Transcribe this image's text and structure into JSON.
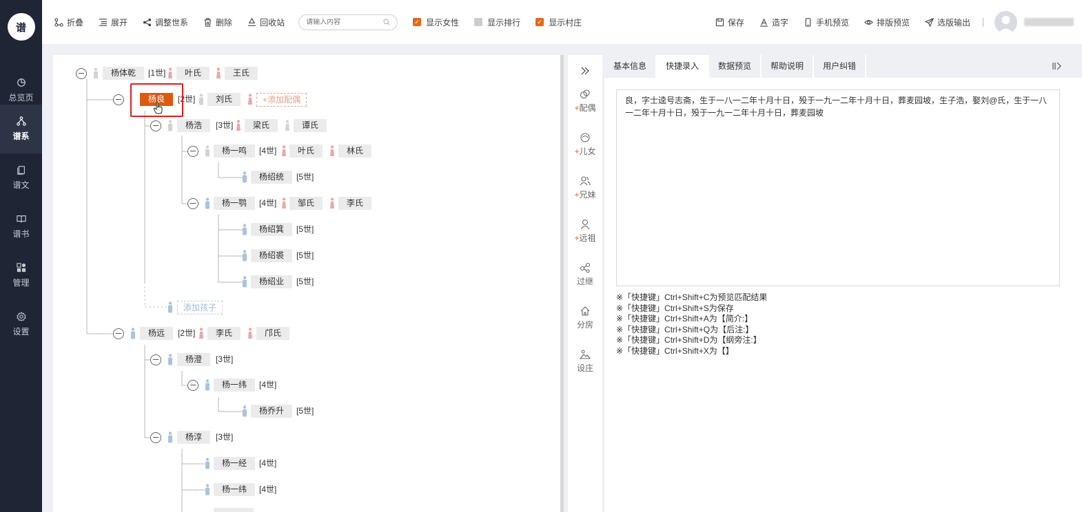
{
  "logo_text": "谱",
  "nav": [
    {
      "label": "总览页",
      "icon": "pie-chart-icon"
    },
    {
      "label": "谱系",
      "icon": "tree-icon",
      "active": true
    },
    {
      "label": "谱文",
      "icon": "document-icon"
    },
    {
      "label": "谱书",
      "icon": "book-icon"
    },
    {
      "label": "管理",
      "icon": "grid-icon"
    },
    {
      "label": "设置",
      "icon": "gear-icon"
    }
  ],
  "toolbar": {
    "collapse": "折叠",
    "expand": "展开",
    "adjust": "调整世系",
    "delete": "删除",
    "recycle": "回收站",
    "search_placeholder": "请输入内容",
    "show_female": "显示女性",
    "show_rank": "显示排行",
    "show_village": "显示村庄",
    "save": "保存",
    "make_char": "造字",
    "mobile_preview": "手机预览",
    "layout_preview": "排版预览",
    "export": "选版输出"
  },
  "checkboxes": {
    "show_female": true,
    "show_rank": false,
    "show_village": true
  },
  "accent_color": "#e0691a",
  "tree": {
    "root": {
      "name": "杨体乾",
      "gen": "[1世]",
      "spouses": [
        "叶氏",
        "王氏"
      ]
    },
    "n_yangliang": {
      "name": "杨良",
      "gen": "[2世]",
      "spouses": [
        "刘氏"
      ],
      "add_spouse": "+添加配偶"
    },
    "n_yanghao": {
      "name": "杨浩",
      "gen": "[3世]",
      "spouses": [
        "梁氏",
        "谭氏"
      ]
    },
    "n_yangyiming": {
      "name": "杨一鸣",
      "gen": "[4世]",
      "spouses": [
        "叶氏",
        "林氏"
      ]
    },
    "n_yangshaotong": {
      "name": "杨绍统",
      "gen": "[5世]"
    },
    "n_yangyipeng": {
      "name": "杨一鹗",
      "gen": "[4世]",
      "spouses": [
        "邹氏",
        "李氏"
      ]
    },
    "n_yangshaoji": {
      "name": "杨绍箕",
      "gen": "[5世]"
    },
    "n_yangshaoqiu": {
      "name": "杨绍裘",
      "gen": "[5世]"
    },
    "n_yangshaoye": {
      "name": "杨绍业",
      "gen": "[5世]"
    },
    "add_child": "添加孩子",
    "n_yangyuan": {
      "name": "杨远",
      "gen": "[2世]",
      "spouses": [
        "李氏",
        "邝氏"
      ]
    },
    "n_yangcheng": {
      "name": "杨澄",
      "gen": "[3世]"
    },
    "n_yangyiwei": {
      "name": "杨一纬",
      "gen": "[4世]"
    },
    "n_yangqiaosheng": {
      "name": "杨乔升",
      "gen": "[5世]"
    },
    "n_yangchun": {
      "name": "杨淳",
      "gen": "[3世]"
    },
    "n_yangyijing": {
      "name": "杨一经",
      "gen": "[4世]"
    },
    "n_yangyiwei2": {
      "name": "杨一纬",
      "gen": "[4世]"
    }
  },
  "actions": [
    {
      "label": "配偶",
      "plus": true,
      "icon": "spouse-icon"
    },
    {
      "label": "儿女",
      "plus": true,
      "icon": "child-icon"
    },
    {
      "label": "兄妹",
      "plus": true,
      "icon": "siblings-icon"
    },
    {
      "label": "远祖",
      "plus": true,
      "icon": "ancestor-icon"
    },
    {
      "label": "过继",
      "plus": false,
      "icon": "adopt-icon"
    },
    {
      "label": "分房",
      "plus": false,
      "icon": "house-icon"
    },
    {
      "label": "设庄",
      "plus": false,
      "icon": "village-icon"
    }
  ],
  "tabs": [
    "基本信息",
    "快捷录入",
    "数据预览",
    "帮助说明",
    "用户纠错"
  ],
  "active_tab": "快捷录入",
  "quick_entry_text": "良，字士逵号志斋，生于一八一二年十月十日，殁于一九一二年十月十日，葬麦园坡，生子浩，娶刘@氏，生于一八一二年十月十日，殁于一九一二年十月十日，葬麦园坡",
  "hints": [
    "※「快捷键」Ctrl+Shift+C为预览匹配结果",
    "※「快捷键」Ctrl+Shift+S为保存",
    "※「快捷键」Ctrl+Shift+A为【简介:】",
    "※「快捷键」Ctrl+Shift+Q为【后注:】",
    "※「快捷键」Ctrl+Shift+D为【纲旁注:】",
    "※「快捷键」Ctrl+Shift+X为【】"
  ]
}
